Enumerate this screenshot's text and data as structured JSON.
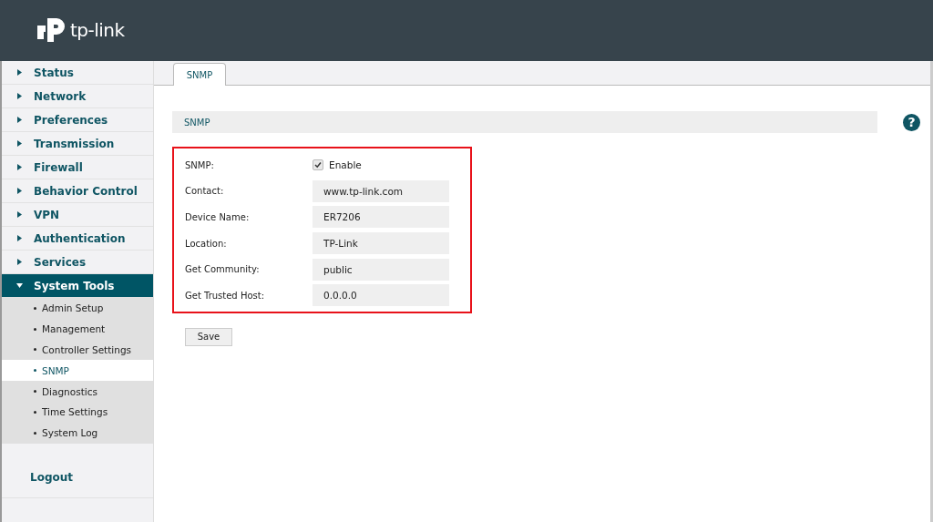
{
  "header": {
    "logo_text": "tp-link"
  },
  "sidebar": {
    "items": [
      {
        "label": "Status",
        "expanded": false
      },
      {
        "label": "Network",
        "expanded": false
      },
      {
        "label": "Preferences",
        "expanded": false
      },
      {
        "label": "Transmission",
        "expanded": false
      },
      {
        "label": "Firewall",
        "expanded": false
      },
      {
        "label": "Behavior Control",
        "expanded": false
      },
      {
        "label": "VPN",
        "expanded": false
      },
      {
        "label": "Authentication",
        "expanded": false
      },
      {
        "label": "Services",
        "expanded": false
      },
      {
        "label": "System Tools",
        "expanded": true,
        "children": [
          {
            "label": "Admin Setup",
            "selected": false
          },
          {
            "label": "Management",
            "selected": false
          },
          {
            "label": "Controller Settings",
            "selected": false
          },
          {
            "label": "SNMP",
            "selected": true
          },
          {
            "label": "Diagnostics",
            "selected": false
          },
          {
            "label": "Time Settings",
            "selected": false
          },
          {
            "label": "System Log",
            "selected": false
          }
        ]
      }
    ],
    "logout": "Logout"
  },
  "tabs": [
    {
      "label": "SNMP",
      "selected": true
    }
  ],
  "section_title": "SNMP",
  "help": "?",
  "form": {
    "rows": [
      {
        "kind": "checkbox",
        "label": "SNMP:",
        "option": "Enable",
        "checked": true
      },
      {
        "kind": "text",
        "label": "Contact:",
        "value": "www.tp-link.com"
      },
      {
        "kind": "text",
        "label": "Device Name:",
        "value": "ER7206"
      },
      {
        "kind": "text",
        "label": "Location:",
        "value": "TP-Link"
      },
      {
        "kind": "text",
        "label": "Get Community:",
        "value": "public"
      },
      {
        "kind": "text",
        "label": "Get Trusted Host:",
        "value": "0.0.0.0"
      }
    ]
  },
  "save_button": "Save"
}
